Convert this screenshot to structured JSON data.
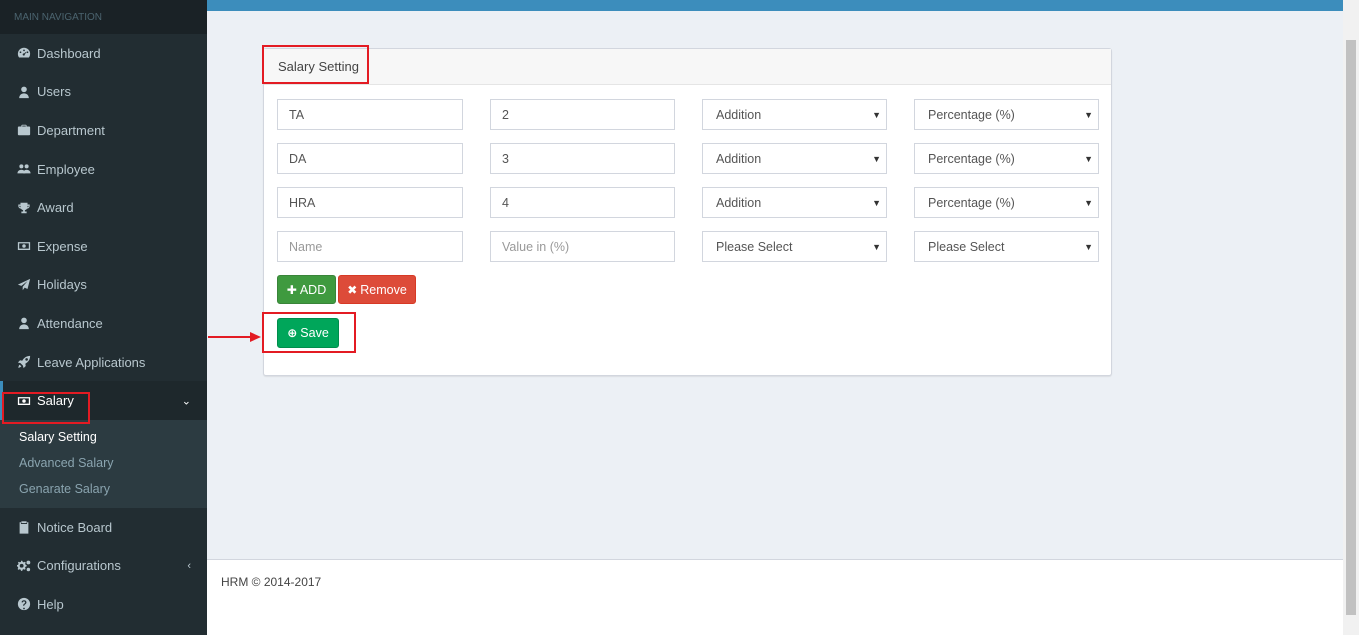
{
  "sidebar": {
    "header": "MAIN NAVIGATION",
    "items": [
      {
        "label": "Dashboard",
        "icon": "dashboard-icon"
      },
      {
        "label": "Users",
        "icon": "user-icon"
      },
      {
        "label": "Department",
        "icon": "briefcase-icon"
      },
      {
        "label": "Employee",
        "icon": "users-icon"
      },
      {
        "label": "Award",
        "icon": "trophy-icon"
      },
      {
        "label": "Expense",
        "icon": "money-icon"
      },
      {
        "label": "Holidays",
        "icon": "paper-plane-icon"
      },
      {
        "label": "Attendance",
        "icon": "user-icon"
      },
      {
        "label": "Leave Applications",
        "icon": "rocket-icon"
      },
      {
        "label": "Salary",
        "icon": "money-icon"
      },
      {
        "label": "Notice Board",
        "icon": "clipboard-icon"
      },
      {
        "label": "Configurations",
        "icon": "cogs-icon"
      },
      {
        "label": "Help",
        "icon": "question-circle-icon"
      }
    ],
    "salary_submenu": [
      {
        "label": "Salary Setting"
      },
      {
        "label": "Advanced Salary"
      },
      {
        "label": "Genarate Salary"
      }
    ]
  },
  "main": {
    "box_title": "Salary Setting",
    "rows": [
      {
        "name": "TA",
        "value": "2",
        "type": "Addition",
        "unit": "Percentage (%)"
      },
      {
        "name": "DA",
        "value": "3",
        "type": "Addition",
        "unit": "Percentage (%)"
      },
      {
        "name": "HRA",
        "value": "4",
        "type": "Addition",
        "unit": "Percentage (%)"
      }
    ],
    "new_row": {
      "name_placeholder": "Name",
      "value_placeholder": "Value in (%)",
      "type_placeholder": "Please Select",
      "unit_placeholder": "Please Select"
    },
    "add_label": "ADD",
    "remove_label": "Remove",
    "save_label": "Save"
  },
  "footer": {
    "text": "HRM © 2014-2017"
  },
  "colors": {
    "sidebar_bg": "#222d32",
    "topbar": "#3c8dbc",
    "add_button": "#3f9a3f",
    "remove_button": "#dd4b39",
    "save_button": "#00a65a",
    "highlight": "#e31b23"
  }
}
